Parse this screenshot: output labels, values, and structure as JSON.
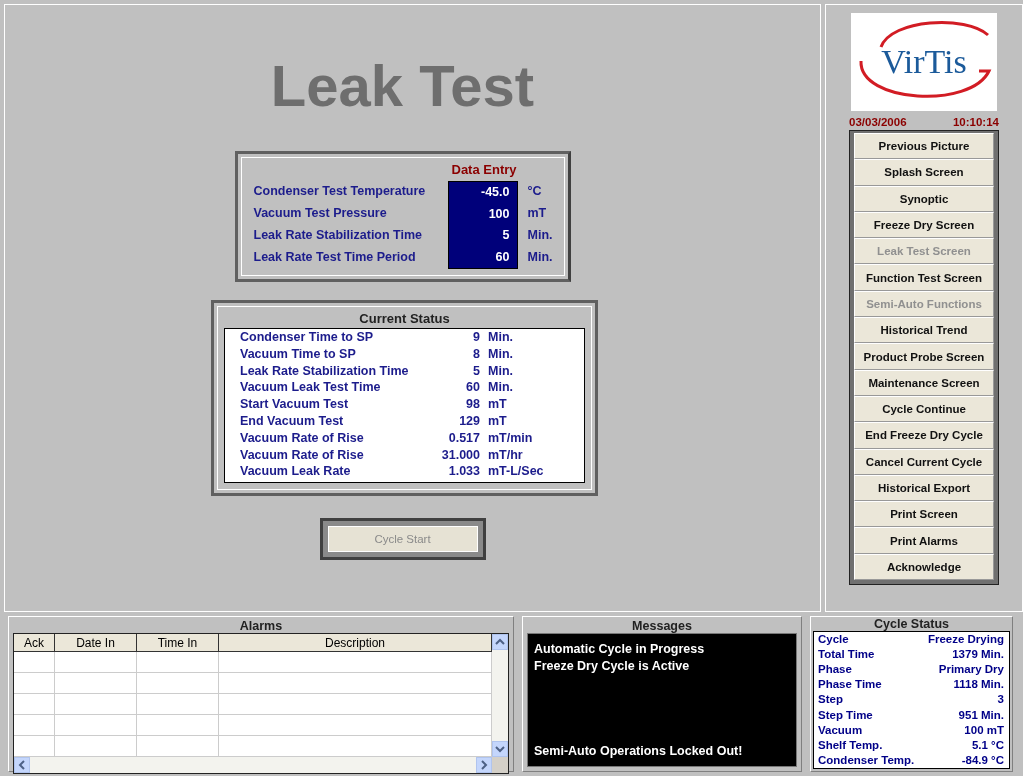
{
  "title": "Leak Test",
  "data_entry": {
    "heading": "Data Entry",
    "rows": [
      {
        "label": "Condenser Test Temperature",
        "value": "-45.0",
        "unit": "°C"
      },
      {
        "label": "Vacuum Test Pressure",
        "value": "100",
        "unit": "mT"
      },
      {
        "label": "Leak Rate Stabilization Time",
        "value": "5",
        "unit": "Min."
      },
      {
        "label": "Leak Rate Test Time Period",
        "value": "60",
        "unit": "Min."
      }
    ]
  },
  "current_status": {
    "heading": "Current Status",
    "rows": [
      {
        "label": "Condenser Time to SP",
        "value": "9",
        "unit": "Min."
      },
      {
        "label": "Vacuum Time to SP",
        "value": "8",
        "unit": "Min."
      },
      {
        "label": "Leak Rate Stabilization Time",
        "value": "5",
        "unit": "Min."
      },
      {
        "label": "Vacuum Leak Test Time",
        "value": "60",
        "unit": "Min."
      },
      {
        "label": "Start Vacuum Test",
        "value": "98",
        "unit": "mT"
      },
      {
        "label": "End Vacuum Test",
        "value": "129",
        "unit": "mT"
      },
      {
        "label": "Vacuum Rate of Rise",
        "value": "0.517",
        "unit": "mT/min"
      },
      {
        "label": "Vacuum Rate of Rise",
        "value": "31.000",
        "unit": "mT/hr"
      },
      {
        "label": "Vacuum Leak Rate",
        "value": "1.033",
        "unit": "mT-L/Sec"
      }
    ]
  },
  "cycle_start": {
    "label": "Cycle Start",
    "disabled": true
  },
  "sidebar": {
    "logo": "VirTis",
    "date": "03/03/2006",
    "time": "10:10:14",
    "buttons": [
      {
        "label": "Previous Picture",
        "disabled": false
      },
      {
        "label": "Splash Screen",
        "disabled": false
      },
      {
        "label": "Synoptic",
        "disabled": false
      },
      {
        "label": "Freeze Dry Screen",
        "disabled": false
      },
      {
        "label": "Leak Test Screen",
        "disabled": true
      },
      {
        "label": "Function Test Screen",
        "disabled": false
      },
      {
        "label": "Semi-Auto Functions",
        "disabled": true
      },
      {
        "label": "Historical Trend",
        "disabled": false
      },
      {
        "label": "Product Probe Screen",
        "disabled": false
      },
      {
        "label": "Maintenance Screen",
        "disabled": false
      },
      {
        "label": "Cycle Continue",
        "disabled": false
      },
      {
        "label": "End Freeze Dry Cycle",
        "disabled": false
      },
      {
        "label": "Cancel Current Cycle",
        "disabled": false
      },
      {
        "label": "Historical Export",
        "disabled": false
      },
      {
        "label": "Print Screen",
        "disabled": false
      },
      {
        "label": "Print Alarms",
        "disabled": false
      },
      {
        "label": "Acknowledge",
        "disabled": false
      }
    ]
  },
  "alarms": {
    "title": "Alarms",
    "columns": [
      "Ack",
      "Date In",
      "Time In",
      "Description"
    ]
  },
  "messages": {
    "title": "Messages",
    "lines": [
      "Automatic Cycle in Progress",
      "Freeze Dry Cycle is Active"
    ],
    "footer": "Semi-Auto Operations Locked Out!"
  },
  "cycle_status": {
    "title": "Cycle Status",
    "rows": [
      {
        "label": "Cycle",
        "value": "Freeze Drying"
      },
      {
        "label": "Total Time",
        "value": "1379 Min."
      },
      {
        "label": "Phase",
        "value": "Primary Dry"
      },
      {
        "label": "Phase Time",
        "value": "1118 Min."
      },
      {
        "label": "Step",
        "value": "3"
      },
      {
        "label": "Step Time",
        "value": "951 Min."
      },
      {
        "label": "Vacuum",
        "value": "100 mT"
      },
      {
        "label": "Shelf Temp.",
        "value": "5.1 °C"
      },
      {
        "label": "Condenser Temp.",
        "value": "-84.9 °C"
      }
    ]
  }
}
